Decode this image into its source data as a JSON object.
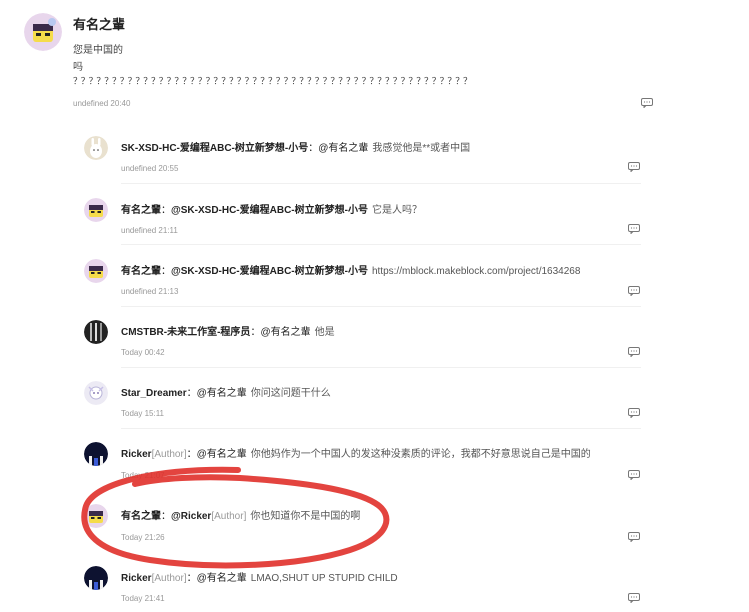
{
  "main_comment": {
    "author": "有名之輩",
    "lines": [
      "您是中国的",
      "吗",
      "？？？？？？？？？？？？？？？？？？？？？？？？？？？？？？？？？？？？？？？？？？？？？？？？？？？"
    ],
    "time": "undefined 20:40",
    "icon": "comment-icon"
  },
  "replies": [
    {
      "author": "SK-XSD-HC-爱编程ABC-树立新梦想-小号",
      "author_tag": "",
      "sep": "：",
      "mention": "@有名之輩",
      "mention_tag": "",
      "text": "我感觉他是**或者中国",
      "time": "undefined 20:55",
      "avatar": "bunny"
    },
    {
      "author": "有名之輩",
      "author_tag": "",
      "sep": "：",
      "mention": "@SK-XSD-HC-爱编程ABC-树立新梦想-小号",
      "mention_tag": "",
      "text": "它是人吗？",
      "time": "undefined 21:11",
      "avatar": "yellow"
    },
    {
      "author": "有名之輩",
      "author_tag": "",
      "sep": "：",
      "mention": "@SK-XSD-HC-爱编程ABC-树立新梦想-小号",
      "mention_tag": "",
      "text": "https://mblock.makeblock.com/project/1634268",
      "time": "undefined 21:13",
      "avatar": "yellow"
    },
    {
      "author": "CMSTBR-未来工作室-程序员",
      "author_tag": "",
      "sep": "：",
      "mention": "@有名之輩",
      "mention_tag": "",
      "text": "他是",
      "time": "Today 00:42",
      "avatar": "dark"
    },
    {
      "author": "Star_Dreamer",
      "author_tag": "",
      "sep": "：",
      "mention": "@有名之輩",
      "mention_tag": "",
      "text": "你问这问题干什么",
      "time": "Today 15:11",
      "avatar": "anime"
    },
    {
      "author": "Ricker",
      "author_tag": "[Author]",
      "sep": "：",
      "mention": "@有名之輩",
      "mention_tag": "",
      "text": "你他妈作为一个中国人的发这种没素质的评论，我都不好意思说自己是中国的",
      "time": "Today 21:07",
      "avatar": "night"
    },
    {
      "author": "有名之輩",
      "author_tag": "",
      "sep": "：",
      "mention": "@Ricker",
      "mention_tag": "[Author]",
      "text": "你也知道你不是中国的啊",
      "time": "Today 21:26",
      "avatar": "yellow"
    },
    {
      "author": "Ricker",
      "author_tag": "[Author]",
      "sep": "：",
      "mention": "@有名之輩",
      "mention_tag": "",
      "text": "LMAO,SHUT UP STUPID CHILD",
      "time": "Today 21:41",
      "avatar": "night"
    }
  ],
  "colors": {
    "annotation_red": "#e0302a",
    "meta_gray": "#999999",
    "name_dark": "#222222",
    "divider": "#f0f0f0"
  }
}
